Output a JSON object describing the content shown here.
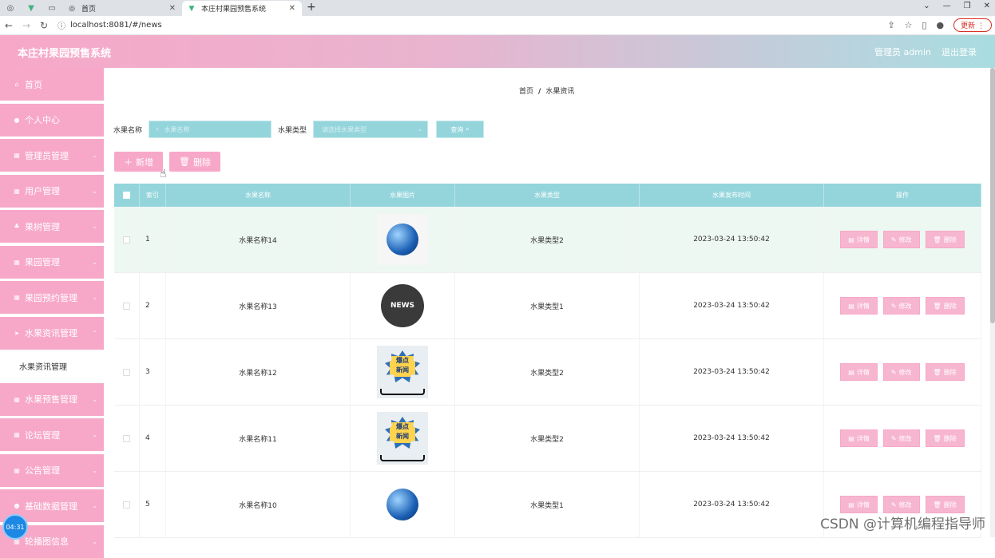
{
  "browser": {
    "tabs": [
      {
        "label": "首页",
        "active": false
      },
      {
        "label": "本庄村果园预售系统",
        "active": true
      }
    ],
    "url": "localhost:8081/#/news",
    "update_label": "更新"
  },
  "header": {
    "title": "本庄村果园预售系统",
    "user": "管理员 admin",
    "logout": "退出登录"
  },
  "sidebar": {
    "items": [
      {
        "label": "首页"
      },
      {
        "label": "个人中心"
      },
      {
        "label": "管理员管理"
      },
      {
        "label": "用户管理"
      },
      {
        "label": "果树管理"
      },
      {
        "label": "果园管理"
      },
      {
        "label": "果园预约管理"
      },
      {
        "label": "水果资讯管理"
      },
      {
        "label": "水果预售管理"
      },
      {
        "label": "论坛管理"
      },
      {
        "label": "公告管理"
      },
      {
        "label": "基础数据管理"
      },
      {
        "label": "轮播图信息"
      }
    ],
    "submenu": "水果资讯管理",
    "timer": "04:31"
  },
  "breadcrumb": {
    "home": "首页",
    "current": "水果资讯"
  },
  "search": {
    "name_label": "水果名称",
    "name_placeholder": "水果名称",
    "type_label": "水果类型",
    "type_placeholder": "请选择水果类型",
    "query": "查询"
  },
  "actions": {
    "add": "新增",
    "delete": "删除"
  },
  "table": {
    "headers": [
      "索引",
      "水果名称",
      "水果图片",
      "水果类型",
      "水果发布时间",
      "操作"
    ],
    "rows": [
      {
        "idx": "1",
        "name": "水果名称14",
        "img": "globe",
        "type": "水果类型2",
        "time": "2023-03-24 13:50:42"
      },
      {
        "idx": "2",
        "name": "水果名称13",
        "img": "news",
        "type": "水果类型1",
        "time": "2023-03-24 13:50:42"
      },
      {
        "idx": "3",
        "name": "水果名称12",
        "img": "baodian",
        "type": "水果类型2",
        "time": "2023-03-24 13:50:42"
      },
      {
        "idx": "4",
        "name": "水果名称11",
        "img": "baodian",
        "type": "水果类型2",
        "time": "2023-03-24 13:50:42"
      },
      {
        "idx": "5",
        "name": "水果名称10",
        "img": "globe",
        "type": "水果类型1",
        "time": "2023-03-24 13:50:42"
      }
    ],
    "ops": {
      "detail": "详情",
      "edit": "修改",
      "delete": "删除"
    }
  },
  "watermark": "CSDN @计算机编程指导师",
  "colors": {
    "pink": "#f7a8c8",
    "teal": "#94d5dc"
  }
}
